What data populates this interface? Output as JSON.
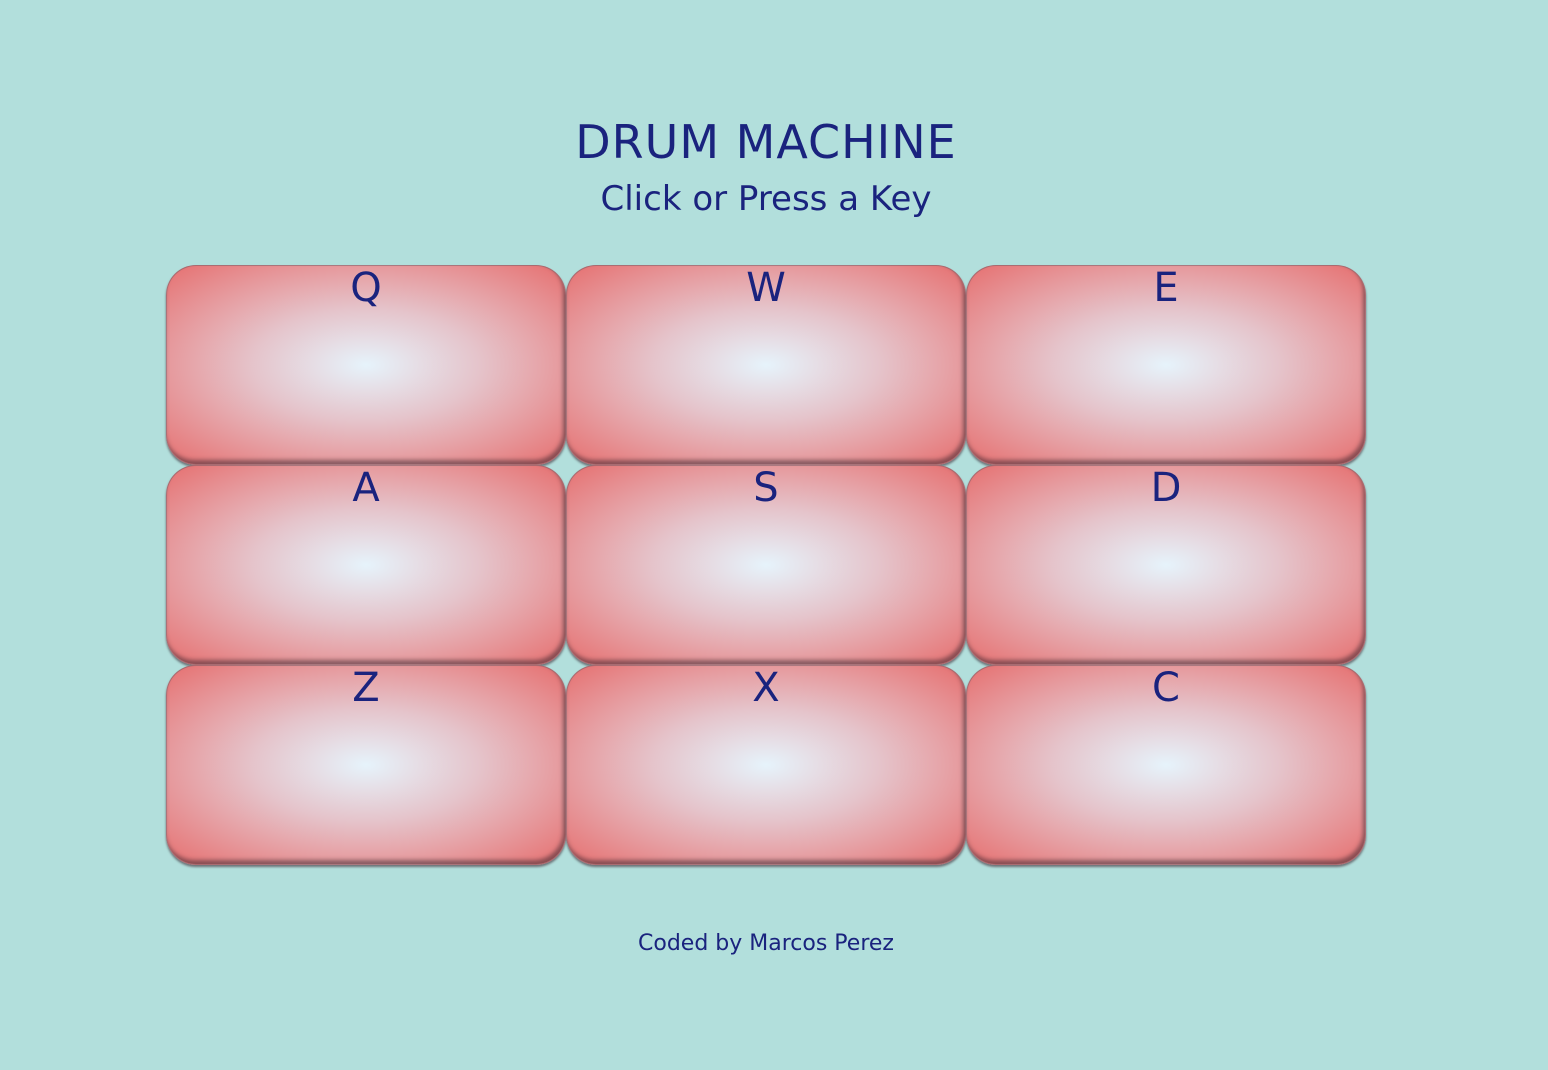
{
  "header": {
    "title": "DRUM MACHINE",
    "subtitle": "Click or Press a Key"
  },
  "pads": [
    {
      "key": "Q"
    },
    {
      "key": "W"
    },
    {
      "key": "E"
    },
    {
      "key": "A"
    },
    {
      "key": "S"
    },
    {
      "key": "D"
    },
    {
      "key": "Z"
    },
    {
      "key": "X"
    },
    {
      "key": "C"
    }
  ],
  "footer": {
    "credit": "Coded by Marcos Perez"
  },
  "colors": {
    "background": "#b2dfdc",
    "text": "#1a237e",
    "pad_edge": "#e67070",
    "pad_center": "#e6f3fb"
  }
}
